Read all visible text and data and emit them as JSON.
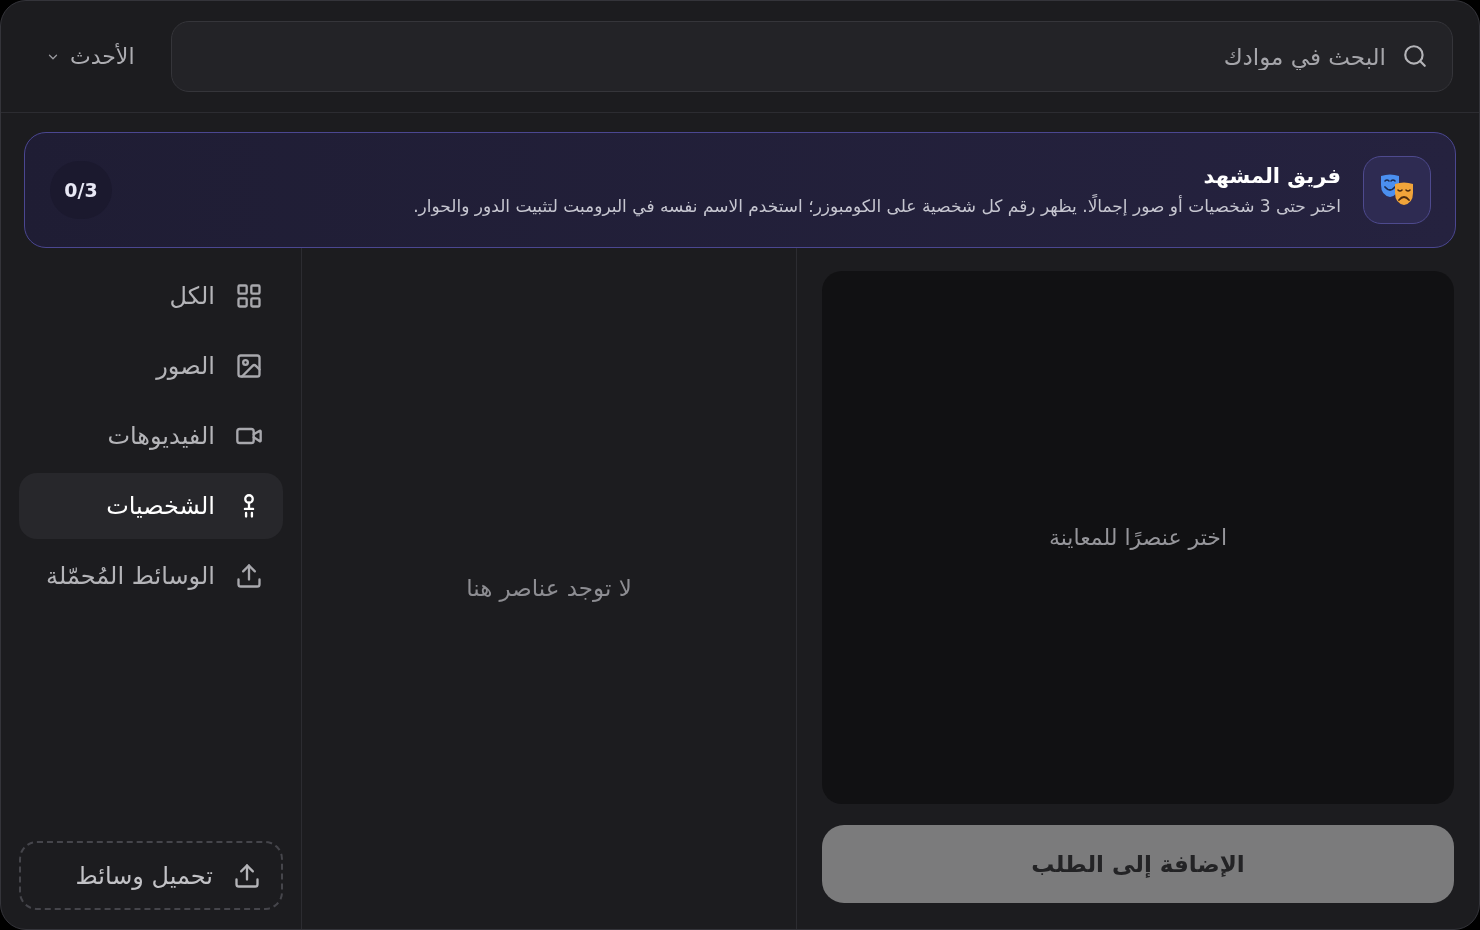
{
  "header": {
    "search": {
      "placeholder": "البحث في موادك"
    },
    "sort": {
      "value": "الأحدث"
    }
  },
  "banner": {
    "title": "فريق المشهد",
    "description": "اختر حتى 3 شخصيات أو صور إجمالًا. يظهر رقم كل شخصية على الكومبوزر؛ استخدم الاسم نفسه في البرومبت لتثبيت الدور والحوار.",
    "counter": "0/3"
  },
  "sidebar": {
    "items": [
      {
        "kind": "all",
        "label": "الكل",
        "selected": false
      },
      {
        "kind": "images",
        "label": "الصور",
        "selected": false
      },
      {
        "kind": "videos",
        "label": "الفيديوهات",
        "selected": false
      },
      {
        "kind": "characters",
        "label": "الشخصيات",
        "selected": true
      },
      {
        "kind": "uploads",
        "label": "الوسائط المُحمّلة",
        "selected": false
      }
    ],
    "upload_button": "تحميل وسائط"
  },
  "list": {
    "empty_text": "لا توجد عناصر هنا"
  },
  "preview": {
    "placeholder": "اختر عنصرًا للمعاينة",
    "add_button": {
      "label": "الإضافة إلى الطلب",
      "disabled": true
    }
  }
}
